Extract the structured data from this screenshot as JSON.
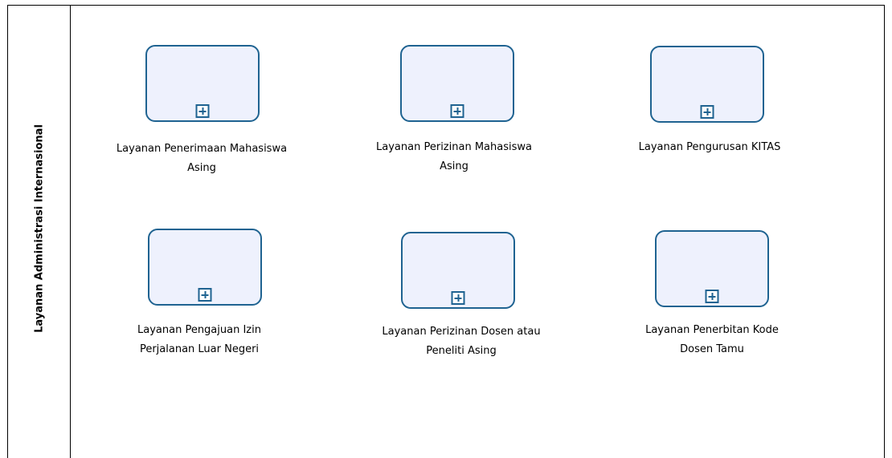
{
  "lane": {
    "title": "Layanan Administrasi Internasional"
  },
  "colors": {
    "task_border": "#1f6391",
    "task_fill": "#eef1fd"
  },
  "tasks": [
    {
      "label": "Layanan Penerimaan Mahasiswa\nAsing",
      "marker": "collapsed-subprocess-plus-icon"
    },
    {
      "label": "Layanan Perizinan Mahasiswa\nAsing",
      "marker": "collapsed-subprocess-plus-icon"
    },
    {
      "label": "Layanan  Pengurusan KITAS",
      "marker": "collapsed-subprocess-plus-icon"
    },
    {
      "label": "Layanan  Pengajuan Izin\nPerjalanan Luar Negeri",
      "marker": "collapsed-subprocess-plus-icon"
    },
    {
      "label": "Layanan  Perizinan Dosen atau\nPeneliti Asing",
      "marker": "collapsed-subprocess-plus-icon"
    },
    {
      "label": "Layanan Penerbitan Kode\nDosen Tamu",
      "marker": "collapsed-subprocess-plus-icon"
    }
  ]
}
